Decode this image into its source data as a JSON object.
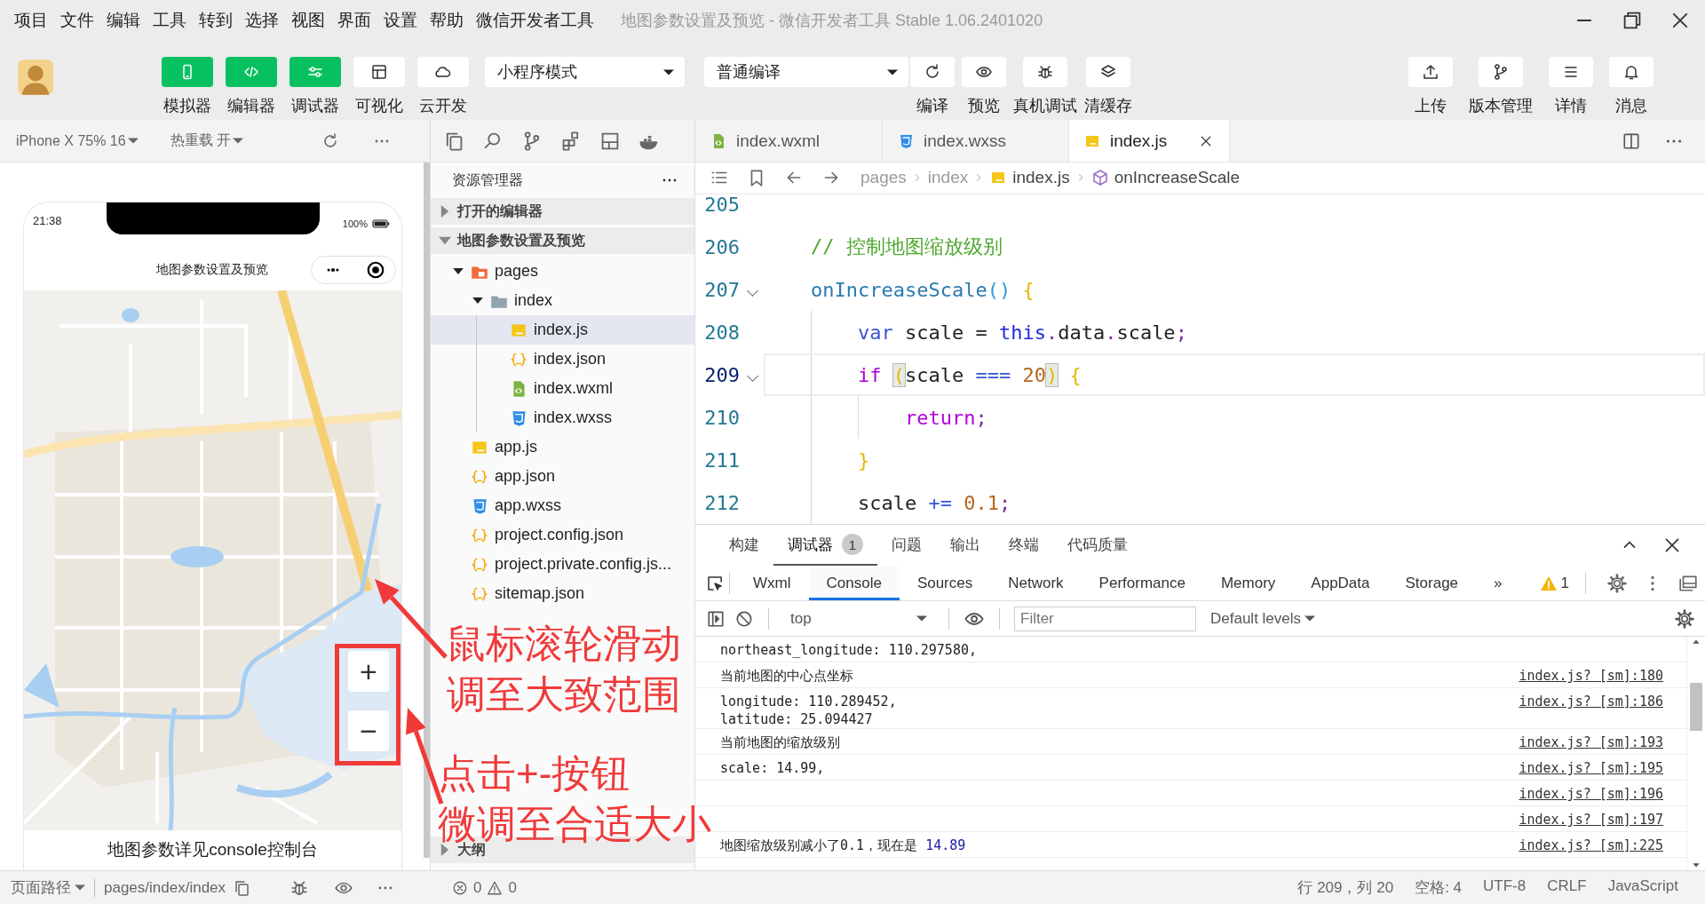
{
  "menu": [
    "项目",
    "文件",
    "编辑",
    "工具",
    "转到",
    "选择",
    "视图",
    "界面",
    "设置",
    "帮助",
    "微信开发者工具"
  ],
  "window_title": "地图参数设置及预览 - 微信开发者工具 Stable 1.06.2401020",
  "toolbar": {
    "views": [
      {
        "label": "模拟器",
        "on": true
      },
      {
        "label": "编辑器",
        "on": true
      },
      {
        "label": "调试器",
        "on": true
      },
      {
        "label": "可视化",
        "on": false
      },
      {
        "label": "云开发",
        "on": false
      }
    ],
    "mode_select": "小程序模式",
    "compile_select": "普通编译",
    "actions": [
      "编译",
      "预览",
      "真机调试",
      "清缓存"
    ],
    "right": [
      "上传",
      "版本管理",
      "详情",
      "消息"
    ]
  },
  "simulator": {
    "device": "iPhone X 75% 16",
    "hot_reload": "热重载 开",
    "phone": {
      "time": "21:38",
      "battery": "100%",
      "title": "地图参数设置及预览",
      "map": {
        "kind": "picture"
      },
      "zoom_buttons": [
        "+",
        "−"
      ],
      "footer_text": "地图参数详见console控制台"
    }
  },
  "explorer": {
    "title": "资源管理器",
    "sections": [
      {
        "label": "打开的编辑器",
        "expanded": false
      },
      {
        "label": "地图参数设置及预览",
        "expanded": true
      }
    ],
    "tree": [
      {
        "name": "pages",
        "kind": "pages-folder",
        "expanded": true,
        "selected": false,
        "children": [
          {
            "name": "index",
            "kind": "folder",
            "expanded": true,
            "selected": false,
            "children": [
              {
                "name": "index.js",
                "kind": "js",
                "selected": true
              },
              {
                "name": "index.json",
                "kind": "json",
                "selected": false
              },
              {
                "name": "index.wxml",
                "kind": "wxml",
                "selected": false
              },
              {
                "name": "index.wxss",
                "kind": "wxss",
                "selected": false
              }
            ]
          }
        ]
      },
      {
        "name": "app.js",
        "kind": "js",
        "selected": false
      },
      {
        "name": "app.json",
        "kind": "json",
        "selected": false
      },
      {
        "name": "app.wxss",
        "kind": "wxss",
        "selected": false
      },
      {
        "name": "project.config.json",
        "kind": "json",
        "selected": false
      },
      {
        "name": "project.private.config.js...",
        "kind": "json",
        "selected": false
      },
      {
        "name": "sitemap.json",
        "kind": "json",
        "selected": false
      }
    ],
    "outline": {
      "label": "大纲",
      "expanded": false
    }
  },
  "editor": {
    "tabs": [
      {
        "name": "index.wxml",
        "kind": "wxml",
        "selected": false
      },
      {
        "name": "index.wxss",
        "kind": "wxss",
        "selected": false
      },
      {
        "name": "index.js",
        "kind": "js",
        "selected": true
      }
    ],
    "breadcrumb": [
      {
        "text": "pages",
        "kind": "folder"
      },
      {
        "text": "index",
        "kind": "folder"
      },
      {
        "text": "index.js",
        "kind": "js"
      },
      {
        "text": "onIncreaseScale",
        "kind": "method"
      }
    ],
    "lines": [
      {
        "number": "205",
        "current": false,
        "foldable": false
      },
      {
        "number": "206",
        "current": false,
        "foldable": false,
        "tokens": [
          {
            "text": "    // 控制地图缩放级别",
            "kind": "comment"
          }
        ]
      },
      {
        "number": "207",
        "current": false,
        "foldable": true,
        "tokens": [
          {
            "text": "    onIncreaseScale",
            "kind": "function"
          },
          {
            "text": "()",
            "kind": "paren"
          },
          {
            "text": " {",
            "kind": "brace"
          }
        ]
      },
      {
        "number": "208",
        "current": false,
        "foldable": false,
        "tokens": [
          {
            "text": "        var",
            "kind": "keyword"
          },
          {
            "text": " scale = ",
            "kind": "plain"
          },
          {
            "text": "this",
            "kind": "this"
          },
          {
            "text": ".",
            "kind": "punct"
          },
          {
            "text": "data",
            "kind": "plain"
          },
          {
            "text": ".",
            "kind": "punct"
          },
          {
            "text": "scale",
            "kind": "plain"
          },
          {
            "text": ";",
            "kind": "punct"
          }
        ]
      },
      {
        "number": "209",
        "current": true,
        "foldable": true,
        "tokens": [
          {
            "text": "        if ",
            "kind": "control"
          },
          {
            "text": "(",
            "kind": "match"
          },
          {
            "text": "scale ",
            "kind": "plain"
          },
          {
            "text": "=== ",
            "kind": "operator"
          },
          {
            "text": "20",
            "kind": "number"
          },
          {
            "text": ")",
            "kind": "match"
          },
          {
            "text": " {",
            "kind": "brace"
          }
        ]
      },
      {
        "number": "210",
        "current": false,
        "foldable": false,
        "tokens": [
          {
            "text": "            return",
            "kind": "control"
          },
          {
            "text": ";",
            "kind": "punct"
          }
        ]
      },
      {
        "number": "211",
        "current": false,
        "foldable": false,
        "tokens": [
          {
            "text": "        }",
            "kind": "brace"
          }
        ]
      },
      {
        "number": "212",
        "current": false,
        "foldable": false,
        "tokens": [
          {
            "text": "        scale ",
            "kind": "plain"
          },
          {
            "text": "+= ",
            "kind": "operator"
          },
          {
            "text": "0.1",
            "kind": "number"
          },
          {
            "text": ";",
            "kind": "punct"
          }
        ]
      }
    ]
  },
  "devtools": {
    "panels": [
      {
        "label": "构建",
        "selected": false
      },
      {
        "label": "调试器",
        "selected": true,
        "badge": "1"
      },
      {
        "label": "问题",
        "selected": false
      },
      {
        "label": "输出",
        "selected": false
      },
      {
        "label": "终端",
        "selected": false
      },
      {
        "label": "代码质量",
        "selected": false
      }
    ],
    "tabs": [
      {
        "label": "Wxml",
        "selected": false
      },
      {
        "label": "Console",
        "selected": true
      },
      {
        "label": "Sources",
        "selected": false
      },
      {
        "label": "Network",
        "selected": false
      },
      {
        "label": "Performance",
        "selected": false
      },
      {
        "label": "Memory",
        "selected": false
      },
      {
        "label": "AppData",
        "selected": false
      },
      {
        "label": "Storage",
        "selected": false
      }
    ],
    "more_tabs": "»",
    "warnings": "1",
    "context": "top",
    "filter_placeholder": "Filter",
    "levels": "Default levels",
    "console": [
      {
        "lines": [
          "northeast_longitude: 110.297580,"
        ]
      },
      {
        "lines": [
          "当前地图的中心点坐标"
        ],
        "source": "index.js? [sm]:180"
      },
      {
        "lines": [
          "longitude: 110.289452,",
          "latitude: 25.094427"
        ],
        "source": "index.js? [sm]:186"
      },
      {
        "lines": [
          "当前地图的缩放级别"
        ],
        "source": "index.js? [sm]:193"
      },
      {
        "lines": [
          "scale: 14.99,"
        ],
        "source": "index.js? [sm]:195"
      },
      {
        "source": "index.js? [sm]:196"
      },
      {
        "source": "index.js? [sm]:197"
      },
      {
        "lines": [
          "地图缩放级别减小了0.1，现在是"
        ],
        "value": "14.89",
        "source": "index.js? [sm]:225"
      }
    ]
  },
  "status_bar": {
    "page_path_label": "页面路径",
    "page_path": "pages/index/index",
    "errors": "0",
    "warnings": "0",
    "cursor": "行 209，列 20",
    "indent": "空格: 4",
    "encoding": "UTF-8",
    "line_ending": "CRLF",
    "language": "JavaScript"
  },
  "annotations": [
    {
      "lines": [
        "鼠标滚轮滑动",
        "调至大致范围"
      ]
    },
    {
      "lines": [
        "点击+-按钮",
        "微调至合适大小"
      ]
    }
  ]
}
